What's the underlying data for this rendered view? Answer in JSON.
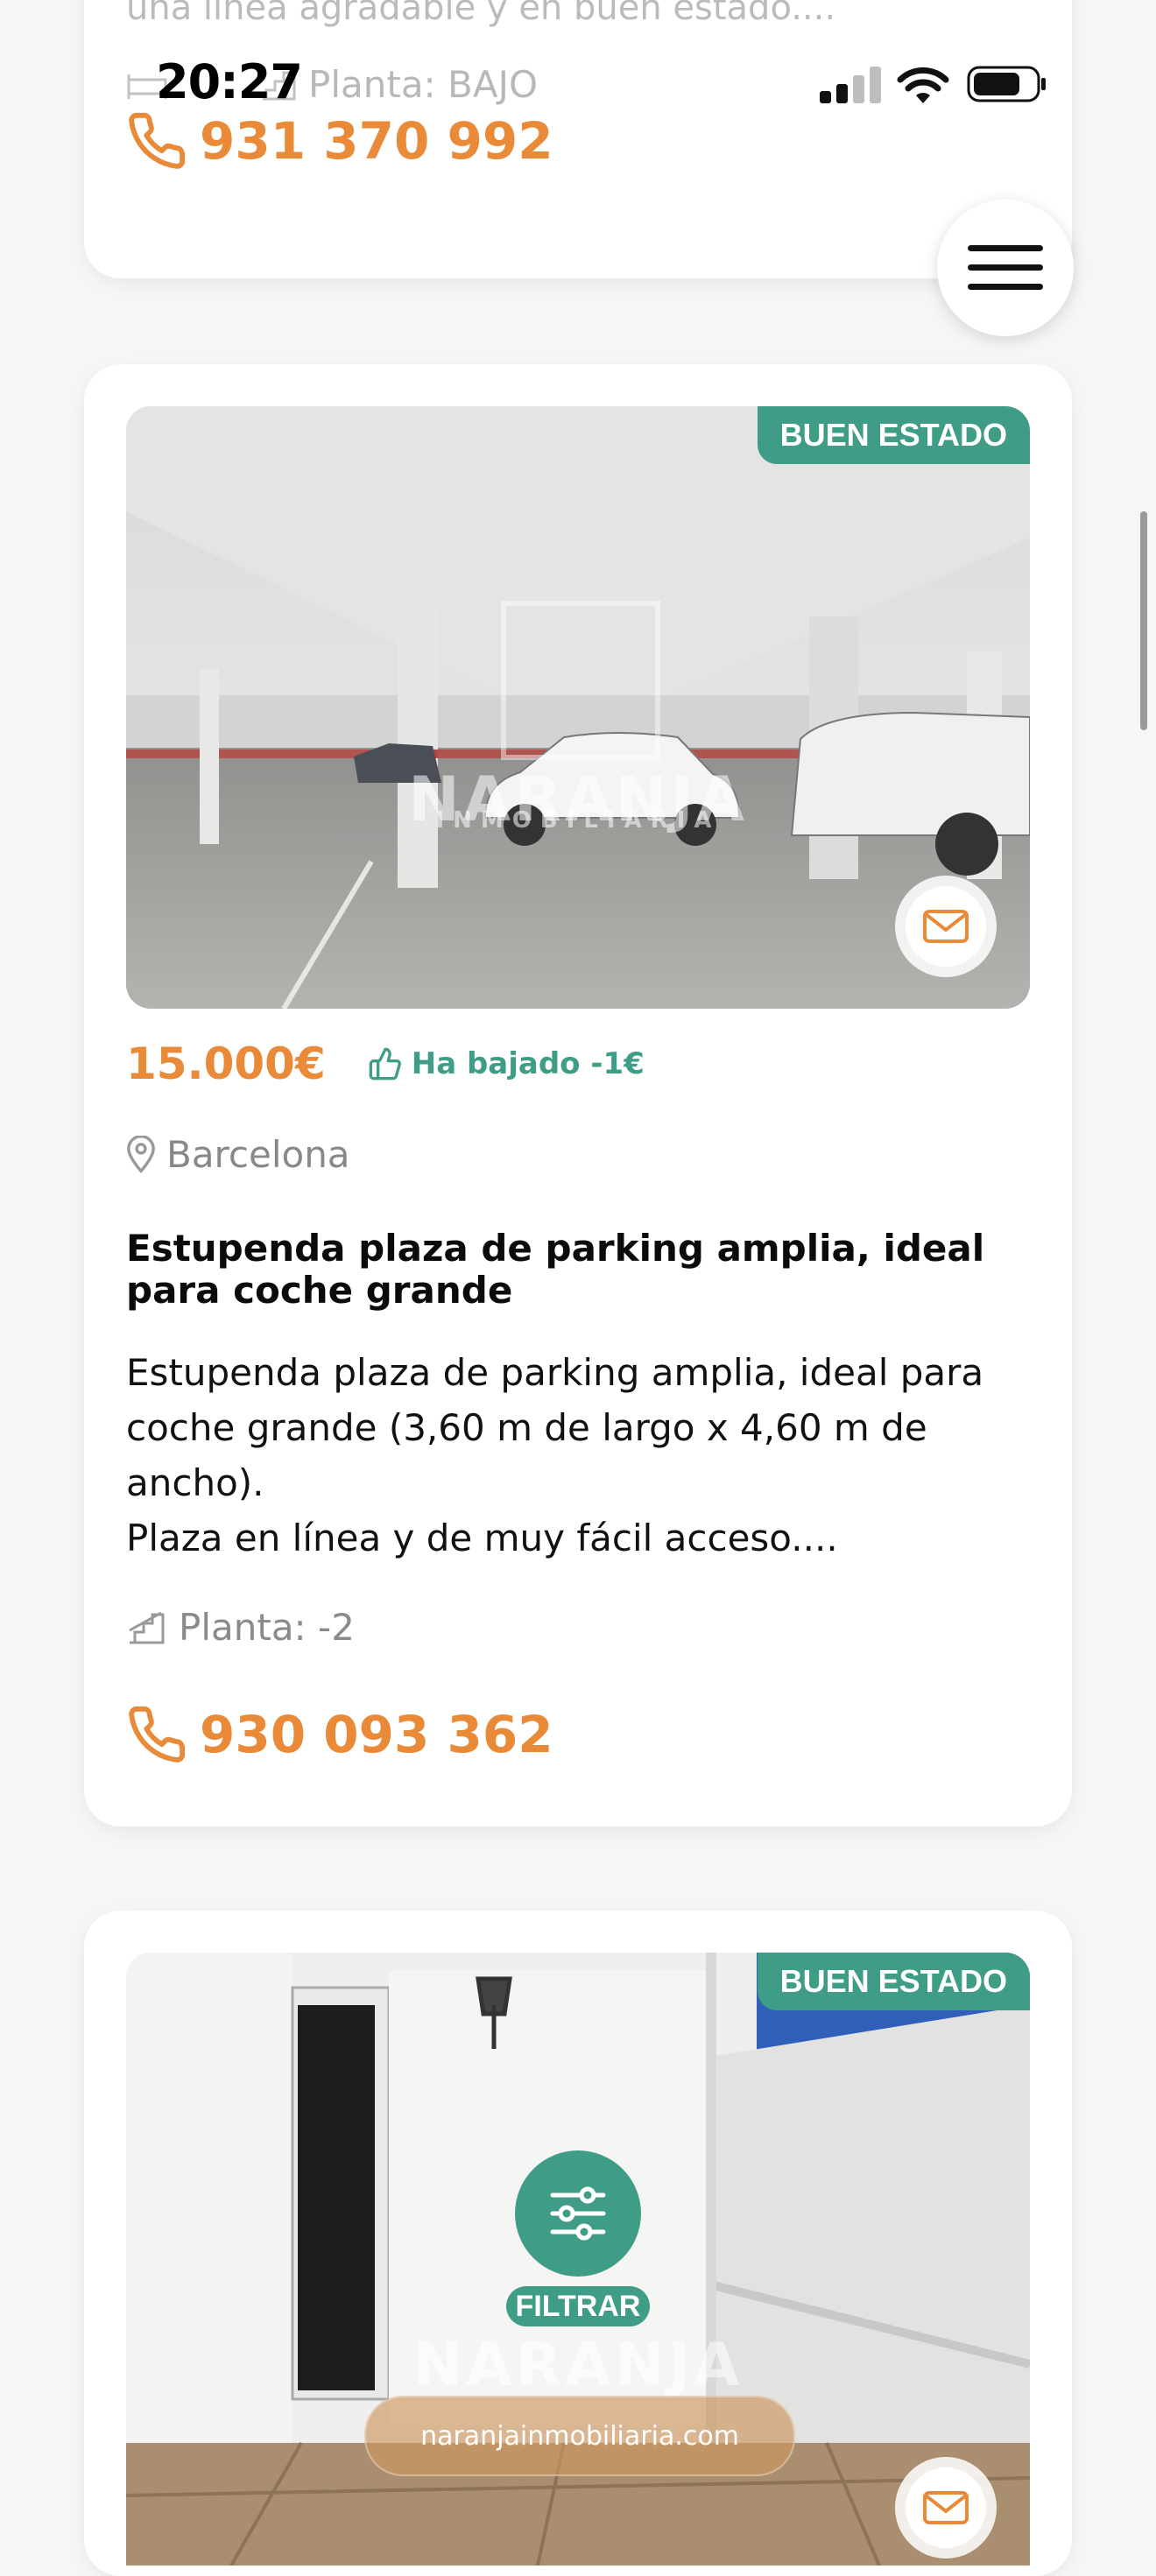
{
  "status_bar": {
    "time": "20:27"
  },
  "colors": {
    "accent_orange": "#e98a39",
    "accent_green": "#3f9d87",
    "text_muted": "#888888"
  },
  "prev_card": {
    "description_tail": "una línea agradable y en buen estado....",
    "floor": "Planta: BAJO",
    "phone": "931 370 992"
  },
  "listing_a": {
    "badge": "BUEN ESTADO",
    "price": "15.000€",
    "price_drop": "Ha bajado -1€",
    "location": "Barcelona",
    "title": "Estupenda plaza de parking amplia, ideal para coche grande",
    "description": "Estupenda plaza de parking amplia, ideal para coche grande (3,60 m de largo x 4,60 m de ancho).\nPlaza en línea y de muy fácil acceso....",
    "floor": "Planta: -2",
    "phone": "930 093 362",
    "watermark_brand": "NARANJA",
    "watermark_sub": "INMOBILIARIA"
  },
  "listing_b": {
    "badge": "BUEN ESTADO",
    "watermark_brand": "NARANJA"
  },
  "floating": {
    "filter_label": "FILTRAR",
    "site_url": "naranjainmobiliaria.com"
  },
  "icons": [
    "phone-icon",
    "menu-icon",
    "mail-icon",
    "thumbs-up-icon",
    "location-pin-icon",
    "stairs-icon",
    "bed-icon",
    "filter-sliders-icon"
  ]
}
